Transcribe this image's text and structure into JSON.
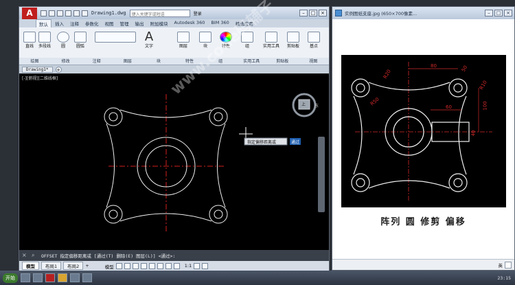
{
  "cad": {
    "logo": "A",
    "file_title": "Drawing1.dwg",
    "search_placeholder": "键入关键字或短语",
    "login": "登录",
    "tabs": [
      "默认",
      "插入",
      "注释",
      "参数化",
      "视图",
      "管理",
      "输出",
      "附加模块",
      "Autodesk 360",
      "BIM 360",
      "精选应用"
    ],
    "active_tab": "默认",
    "panels": [
      "绘图",
      "修改",
      "注释",
      "图层",
      "块",
      "特性",
      "组",
      "实用工具",
      "剪贴板",
      "视图"
    ],
    "tools": {
      "line": "直线",
      "polyline": "多段线",
      "circle": "圆",
      "arc": "圆弧",
      "text": "文字",
      "layers": "图层",
      "block": "块",
      "props": "特性",
      "group": "组",
      "measure": "实用工具",
      "paste": "剪贴板",
      "base": "基点"
    },
    "file_tab": "Drawing1*",
    "viewport_label": "[-][俯视][二维线框]",
    "viewcube_top": "上",
    "viewcube_east": "东",
    "cmd_tooltip": "指定偏移距离或",
    "cmd_value": "通过",
    "command_line": "OFFSET 指定偏移距离或 [通过(T) 删除(E) 图层(L)] <通过>:",
    "layout_tabs": [
      "模型",
      "布局1",
      "布局2"
    ],
    "active_layout": "模型",
    "status_model": "模型",
    "scale": "1:1"
  },
  "viewer": {
    "title": "实例图纸支座.jpg (650×700像素...",
    "caption": "阵列  圆  修剪  偏移",
    "zoom_label": "英",
    "dims": [
      "R20",
      "R50",
      "80",
      "50",
      "R10",
      "100",
      "60",
      "40"
    ]
  },
  "watermark": "www.code码辅子",
  "taskbar": {
    "start": "开始",
    "clock": "23:15"
  },
  "colors": {
    "cad_lines": "#f2f2f2",
    "center_lines": "#d21f1f",
    "drawing_dims": "#d42a2a"
  }
}
